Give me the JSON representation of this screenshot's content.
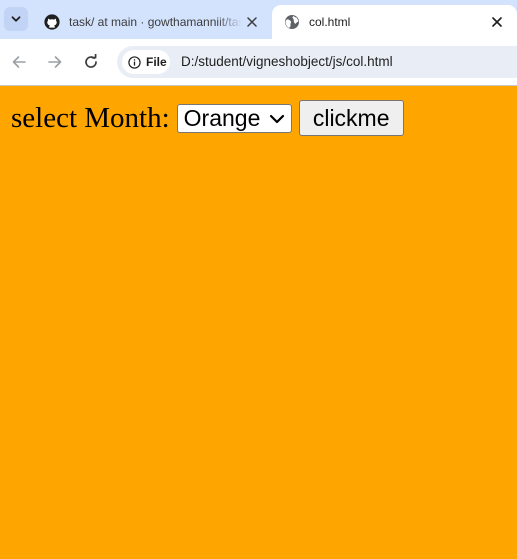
{
  "browser": {
    "tabs": [
      {
        "title": "task/ at main · gowthamanniit/task",
        "icon": "github-icon",
        "active": false
      },
      {
        "title": "col.html",
        "icon": "globe-icon",
        "active": true
      }
    ],
    "address_bar": {
      "chip_label": "File",
      "url": "D:/student/vigneshobject/js/col.html"
    }
  },
  "page": {
    "background_color": "#ffa500",
    "form": {
      "label": "select Month:",
      "select_value": "Orange",
      "button_label": "clickme"
    }
  }
}
